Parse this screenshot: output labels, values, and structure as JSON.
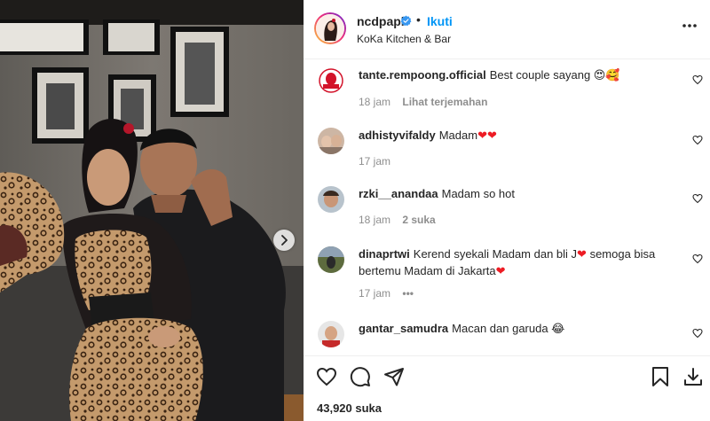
{
  "post": {
    "username": "ncdpapl",
    "separator": "•",
    "follow_label": "Ikuti",
    "location": "KoKa Kitchen & Bar",
    "likes": "43,920 suka"
  },
  "comments": [
    {
      "user": "tante.rempoong.official",
      "text": "Best couple sayang 😍🥰",
      "time": "18 jam",
      "action": "Lihat terjemahan"
    },
    {
      "user": "adhistyvifaldy",
      "text": "Madam",
      "hearts": "❤❤",
      "time": "17 jam",
      "action": ""
    },
    {
      "user": "rzki__anandaa",
      "text": "Madam so hot",
      "time": "18 jam",
      "action": "2 suka"
    },
    {
      "user": "dinaprtwi",
      "text_a": "Kerend syekali Madam dan bli J",
      "heart_a": "❤",
      "text_b": " semoga bisa bertemu Madam di Jakarta",
      "heart_b": "❤",
      "time": "17 jam",
      "action": "•••"
    },
    {
      "user": "gantar_samudra",
      "text": "Macan dan garuda 😂"
    }
  ],
  "colors": {
    "accent": "#0095f6",
    "text": "#262626",
    "muted": "#8e8e8e",
    "heart": "#ed1c24",
    "verified": "#3897f0"
  },
  "icons": [
    "chevron-right-icon",
    "verified-badge-icon",
    "more-options-icon",
    "heart-icon",
    "comment-icon",
    "share-icon",
    "bookmark-icon",
    "download-icon"
  ]
}
